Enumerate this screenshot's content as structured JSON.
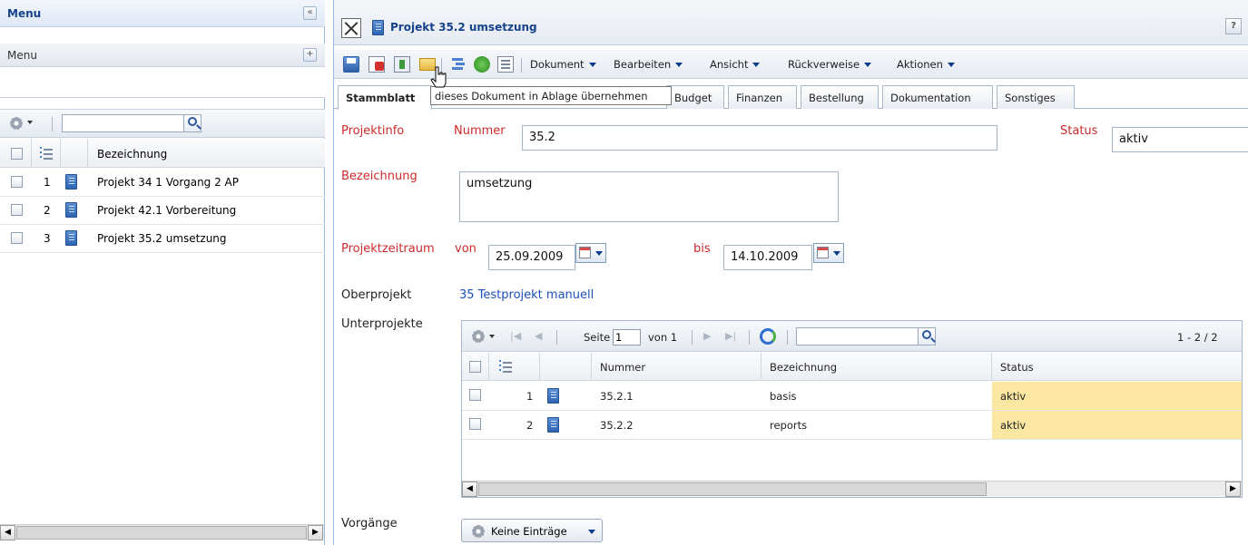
{
  "left_panel": {
    "title": "Menu",
    "menu_row_label": "Menu",
    "collapse_glyph": "«",
    "add_glyph": "+",
    "column_header": "Bezeichnung",
    "rows": [
      {
        "num": "1",
        "label": "Projekt 34 1 Vorgang 2 AP"
      },
      {
        "num": "2",
        "label": "Projekt 42.1 Vorbereitung"
      },
      {
        "num": "3",
        "label": "Projekt 35.2 umsetzung"
      }
    ]
  },
  "right_panel": {
    "title": "Projekt 35.2 umsetzung",
    "help_glyph": "?",
    "toolbar_menus": [
      "Dokument",
      "Bearbeiten",
      "Ansicht",
      "Rückverweise",
      "Aktionen"
    ],
    "tooltip": "dieses Dokument in Ablage übernehmen",
    "tabs": [
      "Stammblatt",
      "Budget",
      "Finanzen",
      "Bestellung",
      "Dokumentation",
      "Sonstiges"
    ],
    "form": {
      "projektinfo_label": "Projektinfo",
      "nummer_label": "Nummer",
      "nummer_value": "35.2",
      "status_label": "Status",
      "status_value": "aktiv",
      "bezeichnung_label": "Bezeichnung",
      "bezeichnung_value": "umsetzung",
      "zeitraum_label": "Projektzeitraum",
      "von_label": "von",
      "von_value": "25.09.2009",
      "bis_label": "bis",
      "bis_value": "14.10.2009",
      "oberprojekt_label": "Oberprojekt",
      "oberprojekt_link": "35 Testprojekt manuell",
      "unterprojekte_label": "Unterprojekte",
      "vorgaenge_label": "Vorgänge",
      "vorgaenge_button": "Keine Einträge"
    },
    "subgrid": {
      "seite_label": "Seite",
      "page_value": "1",
      "von_label": "von 1",
      "range": "1 - 2 / 2",
      "headers": [
        "Nummer",
        "Bezeichnung",
        "Status"
      ],
      "rows": [
        {
          "num": "1",
          "nummer": "35.2.1",
          "bezeichnung": "basis",
          "status": "aktiv"
        },
        {
          "num": "2",
          "nummer": "35.2.2",
          "bezeichnung": "reports",
          "status": "aktiv"
        }
      ]
    }
  },
  "colors": {
    "header_blue": "#15428b",
    "label_red": "#cc2a2a",
    "link_blue": "#1d4fb8",
    "status_yellow": "#fbe7a1"
  }
}
